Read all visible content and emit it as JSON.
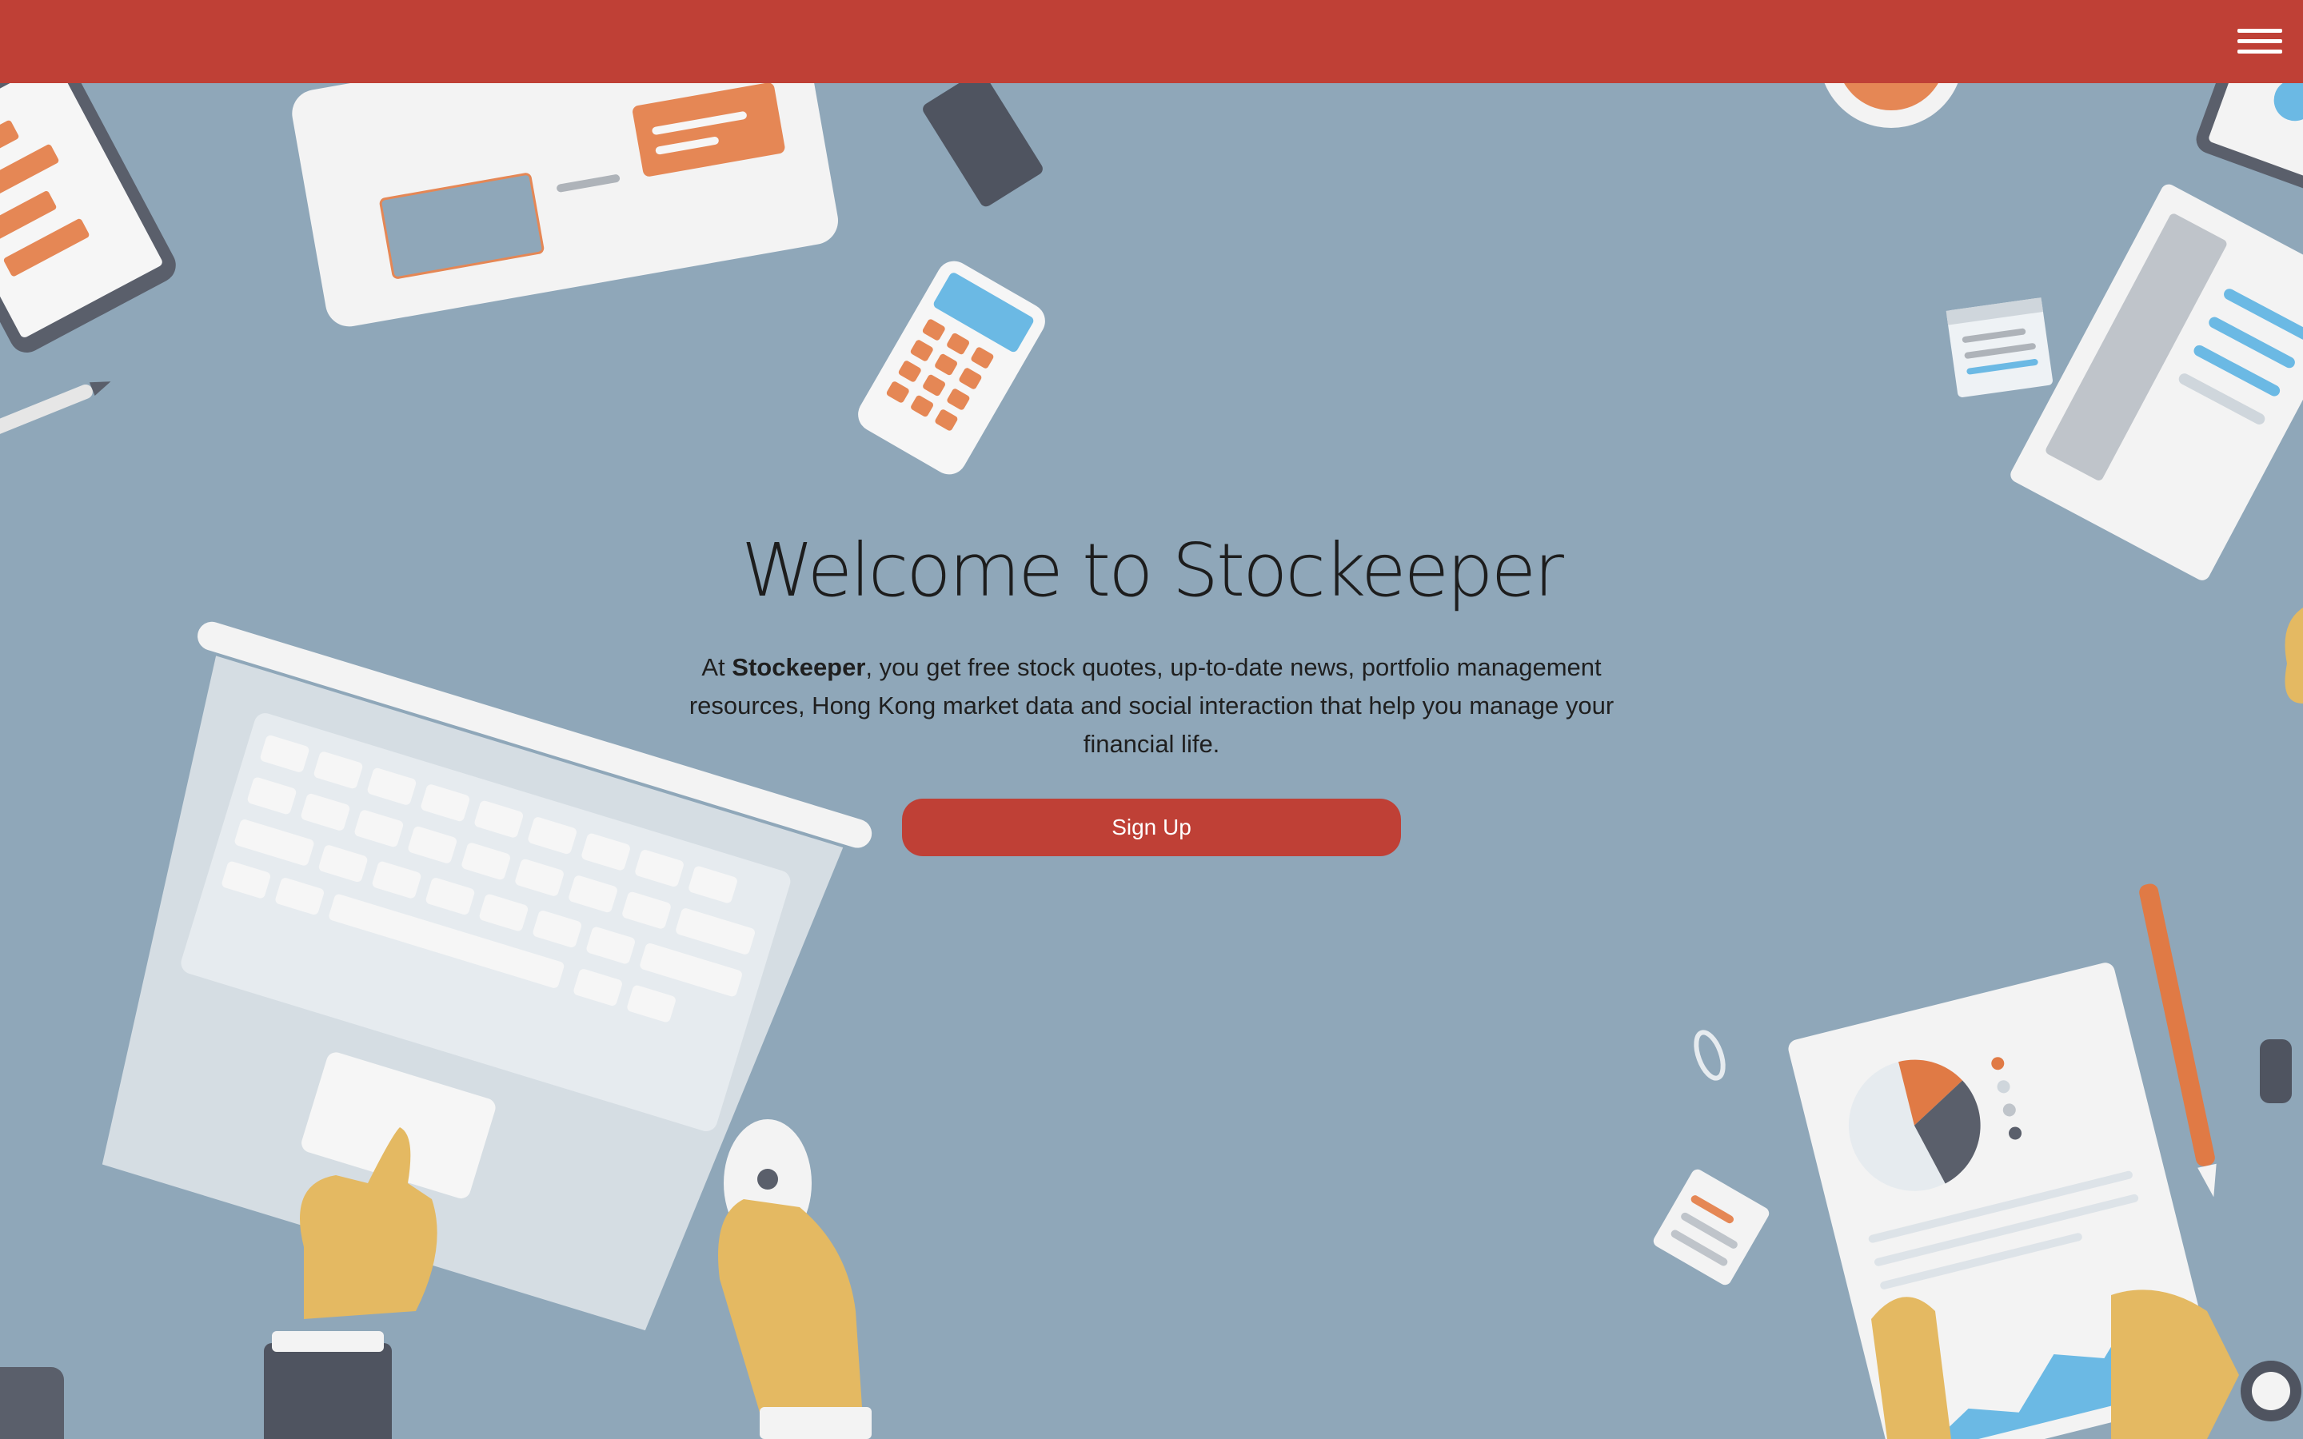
{
  "nav": {
    "menu_icon": "hamburger-menu-icon",
    "brand_color": "#bf4036"
  },
  "hero": {
    "title": "Welcome to Stockeeper",
    "intro_prefix": "At ",
    "intro_brand": "Stockeeper",
    "intro_rest": ", you get free stock quotes, up-to-date news, portfolio management resources, Hong Kong market data and social interaction that help you manage your financial life.",
    "signup_label": "Sign Up"
  },
  "background": {
    "color": "#8fa7b9",
    "scene": "desk-workspace-illustration"
  }
}
